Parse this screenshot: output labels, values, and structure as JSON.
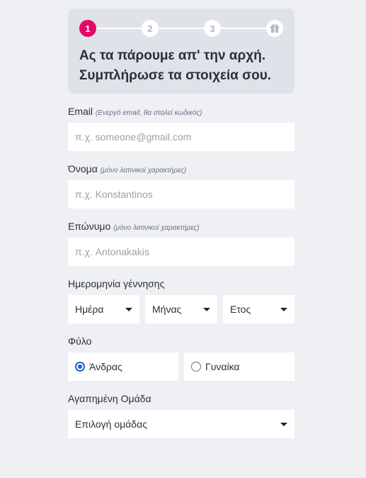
{
  "stepper": {
    "steps": [
      "1",
      "2",
      "3"
    ],
    "final_icon": "gift-icon",
    "active_color": "#e5086a"
  },
  "header": {
    "line1": "Ας τα πάρουμε απ' την αρχή.",
    "line2": "Συμπλήρωσε τα στοιχεία σου."
  },
  "email": {
    "label": "Email",
    "hint": "(Ενεργό email, θα σταλεί κωδικός)",
    "placeholder": "π.χ. someone@gmail.com"
  },
  "first_name": {
    "label": "Όνομα",
    "hint": "(μόνο λατινικοί χαρακτήρες)",
    "placeholder": "π.χ. Konstantinos"
  },
  "last_name": {
    "label": "Επώνυμο",
    "hint": "(μόνο λατινικοί χαρακτήρες)",
    "placeholder": "π.χ. Antonakakis"
  },
  "birthdate": {
    "label": "Ημερομηνία γέννησης",
    "day": "Ημέρα",
    "month": "Μήνας",
    "year": "Ετος"
  },
  "gender": {
    "label": "Φύλο",
    "male": "Άνδρας",
    "female": "Γυναίκα",
    "selected": "male",
    "radio_color": "#1f5fc4"
  },
  "team": {
    "label": "Αγαπημένη Ομάδα",
    "value": "Επιλογή ομάδας"
  }
}
